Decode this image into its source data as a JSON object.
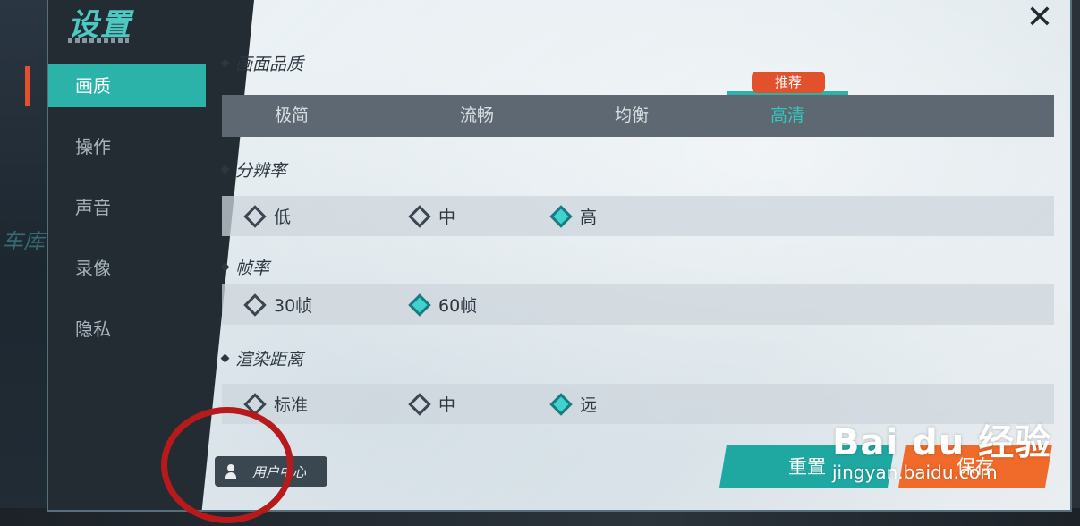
{
  "background": {
    "garage_label": "车库"
  },
  "title": "设置",
  "nav": [
    {
      "label": "画质",
      "active": true
    },
    {
      "label": "操作",
      "active": false
    },
    {
      "label": "声音",
      "active": false
    },
    {
      "label": "录像",
      "active": false
    },
    {
      "label": "隐私",
      "active": false
    }
  ],
  "sections": {
    "quality": {
      "label": "画面品质",
      "options": [
        "极简",
        "流畅",
        "均衡",
        "高清"
      ],
      "selected": "高清",
      "badge": "推荐"
    },
    "resolution": {
      "label": "分辨率",
      "options": [
        "低",
        "中",
        "高"
      ],
      "selected": "高"
    },
    "framerate": {
      "label": "帧率",
      "options": [
        "30帧",
        "60帧"
      ],
      "selected": "60帧"
    },
    "render_distance": {
      "label": "渲染距离",
      "options": [
        "标准",
        "中",
        "远"
      ],
      "selected": "远"
    }
  },
  "user_center": {
    "label": "用户中心",
    "icon": "users-icon"
  },
  "buttons": {
    "reset": "重置",
    "save": "保存"
  },
  "close_icon": "close-icon",
  "watermark": {
    "brand": "Bai du 经验",
    "url": "jingyan.baidu.com"
  },
  "colors": {
    "accent": "#2bb3aa",
    "accent_text": "#34c7bd",
    "save": "#f06a2a",
    "badge": "#e3512c",
    "annotation": "#b61a1a"
  }
}
